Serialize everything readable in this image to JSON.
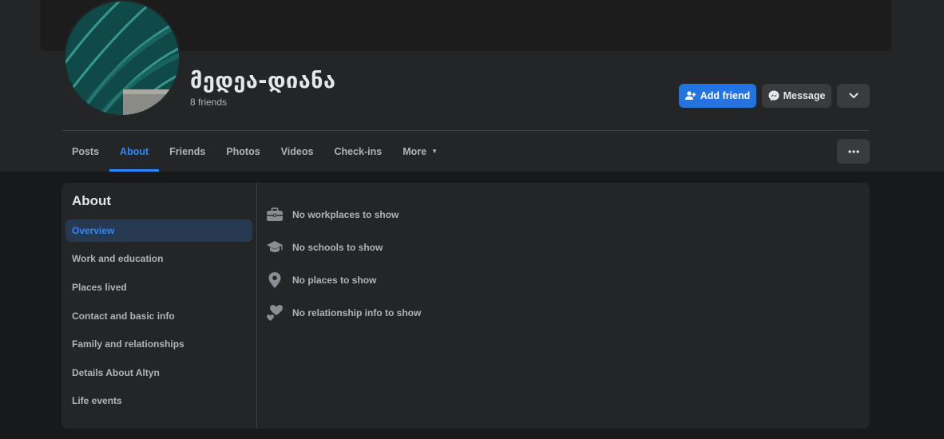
{
  "profile": {
    "name": "მედეა-დიანა",
    "friends": "8 friends"
  },
  "actions": {
    "add_friend": "Add friend",
    "message": "Message"
  },
  "tabs": [
    {
      "label": "Posts"
    },
    {
      "label": "About"
    },
    {
      "label": "Friends"
    },
    {
      "label": "Photos"
    },
    {
      "label": "Videos"
    },
    {
      "label": "Check-ins"
    },
    {
      "label": "More"
    }
  ],
  "about": {
    "title": "About",
    "menu": [
      {
        "label": "Overview"
      },
      {
        "label": "Work and education"
      },
      {
        "label": "Places lived"
      },
      {
        "label": "Contact and basic info"
      },
      {
        "label": "Family and relationships"
      },
      {
        "label": "Details About Altyn"
      },
      {
        "label": "Life events"
      }
    ],
    "rows": [
      {
        "icon": "briefcase-icon",
        "text": "No workplaces to show"
      },
      {
        "icon": "graduation-cap-icon",
        "text": "No schools to show"
      },
      {
        "icon": "location-pin-icon",
        "text": "No places to show"
      },
      {
        "icon": "hearts-icon",
        "text": "No relationship info to show"
      }
    ]
  },
  "colors": {
    "accent": "#2d88ff",
    "button_primary": "#2374e1",
    "background": "#18191a",
    "surface": "#242526"
  }
}
